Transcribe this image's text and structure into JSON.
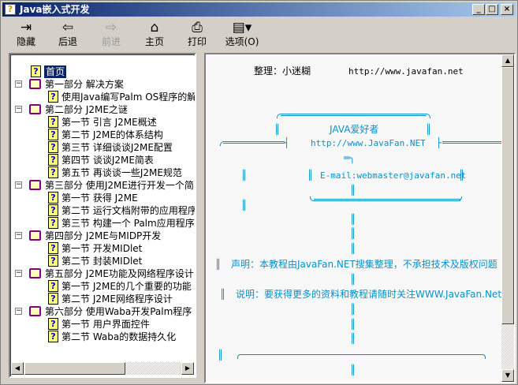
{
  "window": {
    "title": "Java嵌入式开发",
    "minimize": "_",
    "maximize": "□",
    "close": "×",
    "app_icon": "?"
  },
  "toolbar": {
    "hide": {
      "label": "隐藏",
      "icon": "⇥"
    },
    "back": {
      "label": "后退",
      "icon": "⇦"
    },
    "forward": {
      "label": "前进",
      "icon": "⇨"
    },
    "home": {
      "label": "主页",
      "icon": "⌂"
    },
    "print": {
      "label": "打印",
      "icon": "⎙"
    },
    "options": {
      "label": "选项(O)",
      "icon": "▤▾"
    }
  },
  "tree": {
    "home": "首页",
    "question_icon": "?",
    "collapse": "−",
    "items": [
      {
        "label": "第一部分 解决方案"
      },
      {
        "label": "使用Java编写Palm OS程序的解决方案"
      },
      {
        "label": "第二部分 J2ME之谜"
      },
      {
        "label": "第一节 引言 J2ME概述"
      },
      {
        "label": "第二节 J2ME的体系结构"
      },
      {
        "label": "第三节 详细谈谈J2ME配置"
      },
      {
        "label": "第四节 谈谈J2ME简表"
      },
      {
        "label": "第五节 再谈谈一些J2ME规范"
      },
      {
        "label": "第三部分 使用J2ME进行开发一个简"
      },
      {
        "label": "第一节 获得 J2ME"
      },
      {
        "label": "第二节 运行文档附带的应用程序"
      },
      {
        "label": "第三节 构建一个 Palm应用程序"
      },
      {
        "label": "第四部分 J2ME与MIDP开发"
      },
      {
        "label": "第一节  开发MIDlet"
      },
      {
        "label": "第二节 封装MIDlet"
      },
      {
        "label": "第五部分 J2ME功能及网络程序设计"
      },
      {
        "label": "第一节 J2ME的几个重要的功能"
      },
      {
        "label": "第二节 J2ME网络程序设计"
      },
      {
        "label": "第六部分 使用Waba开发Palm程序"
      },
      {
        "label": "第一节 用户界面控件"
      },
      {
        "label": "第二节 Waba的数据持久化"
      }
    ]
  },
  "content": {
    "organizer": "整理：小迷糊",
    "site": "http://www.javafan.net",
    "banner_title": "JAVA爱好者",
    "banner_url": "http://www.JavaFan.NET",
    "email": "E-mail:webmaster@javafan.net",
    "statement": "声明：本教程由JavaFan.NET搜集整理，不承担技术及版权问题",
    "note": "说明：要获得更多的资料和教程请随时关注WWW.JavaFan.Net",
    "bar": "║",
    "tee_left": "┤",
    "tee_right": "├",
    "joint": "═╮"
  },
  "scroll": {
    "up": "▲",
    "down": "▼",
    "left": "◀",
    "right": "▶"
  }
}
